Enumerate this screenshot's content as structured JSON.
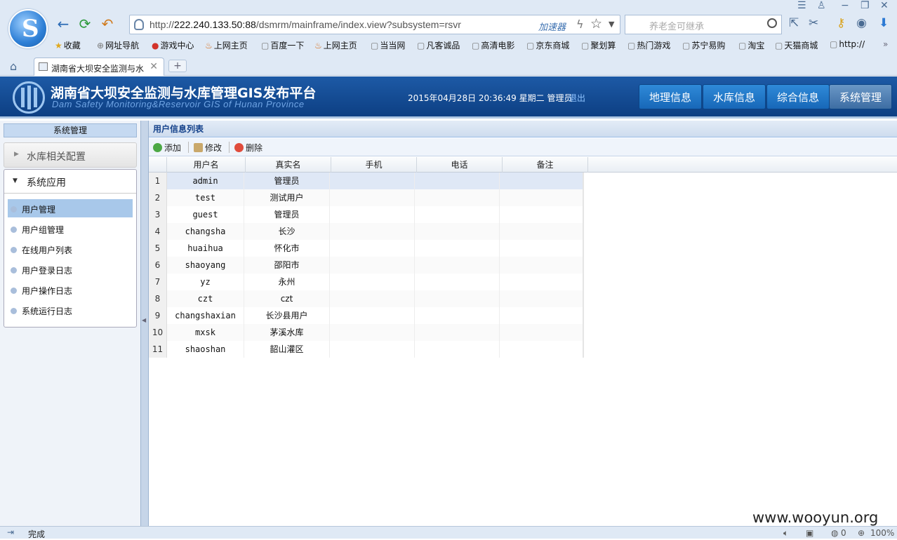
{
  "browser": {
    "url_prefix": "http://",
    "url_host": "222.240.133.50:88",
    "url_path": "/dsmrm/mainframe/index.view?subsystem=rsvr",
    "accelerator_label": "加速器",
    "search_placeholder": "养老金可继承",
    "bookmarks": [
      "收藏",
      "网址导航",
      "游戏中心",
      "上网主页",
      "百度一下",
      "上网主页",
      "当当网",
      "凡客诚品",
      "高清电影",
      "京东商城",
      "聚划算",
      "热门游戏",
      "苏宁易购",
      "淘宝",
      "天猫商城",
      "http://"
    ],
    "tab_title": "湖南省大坝安全监测与水",
    "status_text": "完成",
    "status_count": "0",
    "zoom": "100%"
  },
  "app": {
    "title": "湖南省大坝安全监测与水库管理GIS发布平台",
    "subtitle": "Dam Safety Monitoring&Reservoir GIS of Hunan Province",
    "datetime": "2015年04月28日 20:36:49 星期二",
    "user": "管理员",
    "logout": "退出",
    "nav": [
      "地理信息",
      "水库信息",
      "综合信息",
      "系统管理"
    ]
  },
  "sidebar": {
    "title": "系统管理",
    "group1": "水库相关配置",
    "group2": "系统应用",
    "items": [
      "用户管理",
      "用户组管理",
      "在线用户列表",
      "用户登录日志",
      "用户操作日志",
      "系统运行日志"
    ]
  },
  "main": {
    "title": "用户信息列表",
    "toolbar": {
      "add": "添加",
      "edit": "修改",
      "delete": "删除"
    },
    "columns": [
      "用户名",
      "真实名",
      "手机",
      "电话",
      "备注"
    ],
    "rows": [
      [
        "1",
        "admin",
        "管理员"
      ],
      [
        "2",
        "test",
        "测试用户"
      ],
      [
        "3",
        "guest",
        "管理员"
      ],
      [
        "4",
        "changsha",
        "长沙"
      ],
      [
        "5",
        "huaihua",
        "怀化市"
      ],
      [
        "6",
        "shaoyang",
        "邵阳市"
      ],
      [
        "7",
        "yz",
        "永州"
      ],
      [
        "8",
        "czt",
        "czt"
      ],
      [
        "9",
        "changshaxian",
        "长沙县用户"
      ],
      [
        "10",
        "mxsk",
        "茅溪水库"
      ],
      [
        "11",
        "shaoshan",
        "韶山灌区"
      ]
    ]
  },
  "watermark": "www.wooyun.org"
}
